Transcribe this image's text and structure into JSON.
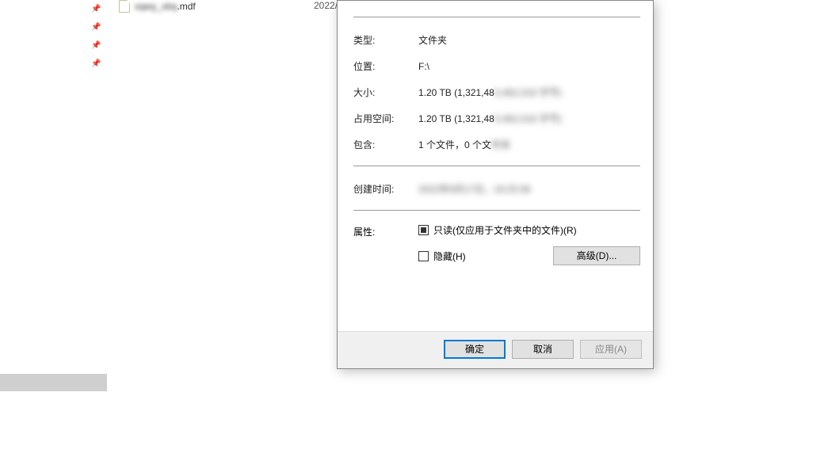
{
  "explorer": {
    "file": {
      "name_prefix_blurred": "xqwy_xbq",
      "name_suffix": ".mdf",
      "date_partial": "2022/"
    }
  },
  "dialog": {
    "rows": {
      "type": {
        "label": "类型:",
        "value": "文件夹"
      },
      "location": {
        "label": "位置:",
        "value": "F:\\"
      },
      "size": {
        "label": "大小:",
        "value_visible": "1.20 TB (1,321,48",
        "value_blurred": "0,462,016 字节)"
      },
      "size_on_disk": {
        "label": "占用空间:",
        "value_visible": "1.20 TB (1,321,48",
        "value_blurred": "0,462,016 字节)"
      },
      "contains": {
        "label": "包含:",
        "value_visible": "1 个文件，0 个文",
        "value_blurred": "件夹"
      },
      "created": {
        "label": "创建时间:",
        "value_blurred": "2022年9月17日，19:25:08"
      },
      "attributes": {
        "label": "属性:"
      }
    },
    "attributes": {
      "readonly_label": "只读(仅应用于文件夹中的文件)(R)",
      "hidden_label": "隐藏(H)",
      "advanced_button": "高级(D)..."
    },
    "buttons": {
      "ok": "确定",
      "cancel": "取消",
      "apply": "应用(A)"
    }
  }
}
